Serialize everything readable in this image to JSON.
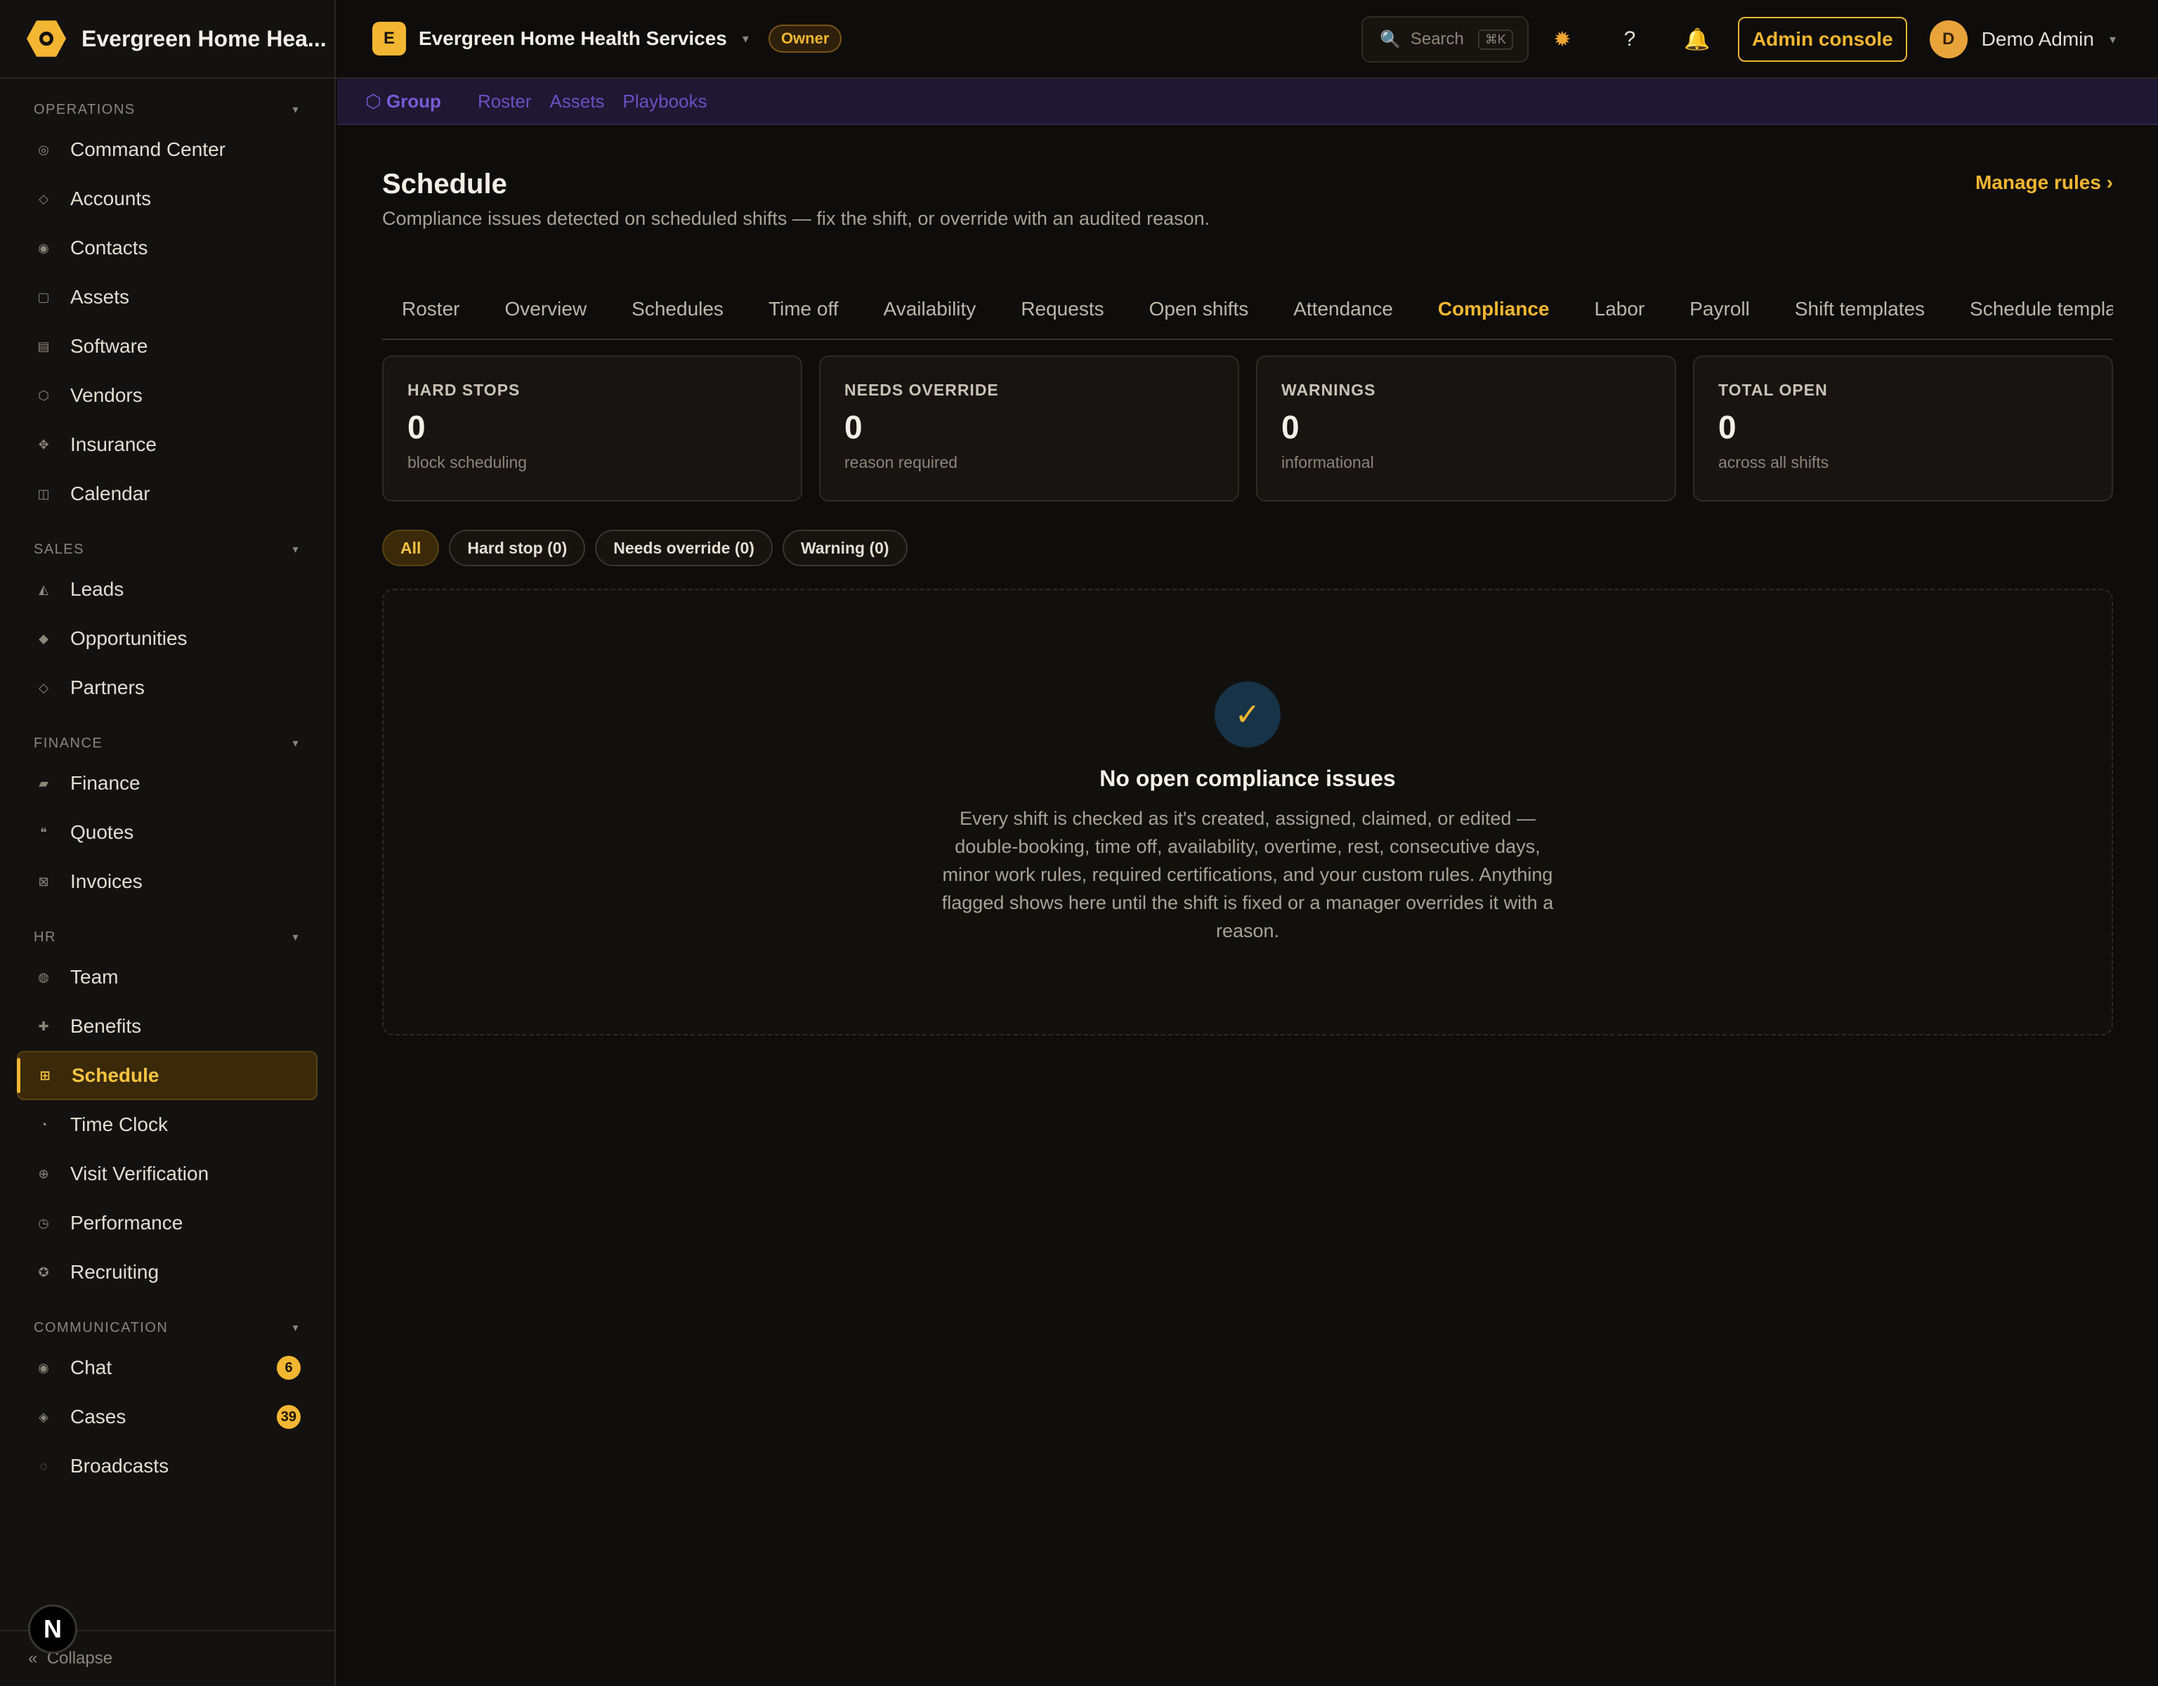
{
  "brand": {
    "name": "Evergreen Home Hea...",
    "logo_color": "#f2b632"
  },
  "sidebar": {
    "sections": [
      {
        "title": "OPERATIONS",
        "items": [
          {
            "label": "Command Center",
            "icon": "target-icon"
          },
          {
            "label": "Accounts",
            "icon": "diamond-icon"
          },
          {
            "label": "Contacts",
            "icon": "contact-icon"
          },
          {
            "label": "Assets",
            "icon": "box-icon"
          },
          {
            "label": "Software",
            "icon": "list-icon"
          },
          {
            "label": "Vendors",
            "icon": "hexagon-icon"
          },
          {
            "label": "Insurance",
            "icon": "shield-icon"
          },
          {
            "label": "Calendar",
            "icon": "calendar-icon"
          }
        ]
      },
      {
        "title": "SALES",
        "items": [
          {
            "label": "Leads",
            "icon": "triangle-icon"
          },
          {
            "label": "Opportunities",
            "icon": "diamond-filled-icon"
          },
          {
            "label": "Partners",
            "icon": "diamond-icon"
          }
        ]
      },
      {
        "title": "FINANCE",
        "items": [
          {
            "label": "Finance",
            "icon": "card-icon"
          },
          {
            "label": "Quotes",
            "icon": "quote-icon"
          },
          {
            "label": "Invoices",
            "icon": "invoice-icon"
          }
        ]
      },
      {
        "title": "HR",
        "items": [
          {
            "label": "Team",
            "icon": "team-icon"
          },
          {
            "label": "Benefits",
            "icon": "plus-icon"
          },
          {
            "label": "Schedule",
            "icon": "grid-icon",
            "active": true
          },
          {
            "label": "Time Clock",
            "icon": "clock-icon"
          },
          {
            "label": "Visit Verification",
            "icon": "globe-icon"
          },
          {
            "label": "Performance",
            "icon": "gauge-icon"
          },
          {
            "label": "Recruiting",
            "icon": "gear-icon"
          }
        ]
      },
      {
        "title": "COMMUNICATION",
        "items": [
          {
            "label": "Chat",
            "icon": "chat-icon",
            "badge": "6"
          },
          {
            "label": "Cases",
            "icon": "case-icon",
            "badge": "39"
          },
          {
            "label": "Broadcasts",
            "icon": "broadcast-icon"
          }
        ]
      }
    ],
    "collapse_label": "Collapse",
    "avatar_letter": "N"
  },
  "topbar": {
    "org_initial": "E",
    "org_name": "Evergreen Home Health Services",
    "role_badge": "Owner",
    "search_placeholder": "Search",
    "search_shortcut": "⌘K",
    "admin_label": "Admin console",
    "user_initial": "D",
    "user_name": "Demo Admin"
  },
  "subbar": {
    "items": [
      "Group",
      "Roster",
      "Assets",
      "Playbooks"
    ]
  },
  "page": {
    "title": "Schedule",
    "subtitle": "Compliance issues detected on scheduled shifts — fix the shift, or override with an audited reason.",
    "manage_rules": "Manage rules ›"
  },
  "tabs": [
    "Roster",
    "Overview",
    "Schedules",
    "Time off",
    "Availability",
    "Requests",
    "Open shifts",
    "Attendance",
    "Compliance",
    "Labor",
    "Payroll",
    "Shift templates",
    "Schedule templates"
  ],
  "active_tab": "Compliance",
  "stats": [
    {
      "label": "HARD STOPS",
      "value": "0",
      "note": "block scheduling"
    },
    {
      "label": "NEEDS OVERRIDE",
      "value": "0",
      "note": "reason required"
    },
    {
      "label": "WARNINGS",
      "value": "0",
      "note": "informational"
    },
    {
      "label": "TOTAL OPEN",
      "value": "0",
      "note": "across all shifts"
    }
  ],
  "filters": [
    "All",
    "Hard stop (0)",
    "Needs override (0)",
    "Warning (0)"
  ],
  "empty_state": {
    "icon": "✓",
    "title": "No open compliance issues",
    "body": "Every shift is checked as it's created, assigned, claimed, or edited — double-booking, time off, availability, overtime, rest, consecutive days, minor work rules, required certifications, and your custom rules. Anything flagged shows here until the shift is fixed or a manager overrides it with a reason."
  },
  "colors": {
    "accent": "#f2b632",
    "background": "#0f0d0b",
    "subbar": "#1f1833",
    "check_bg": "#173347"
  }
}
